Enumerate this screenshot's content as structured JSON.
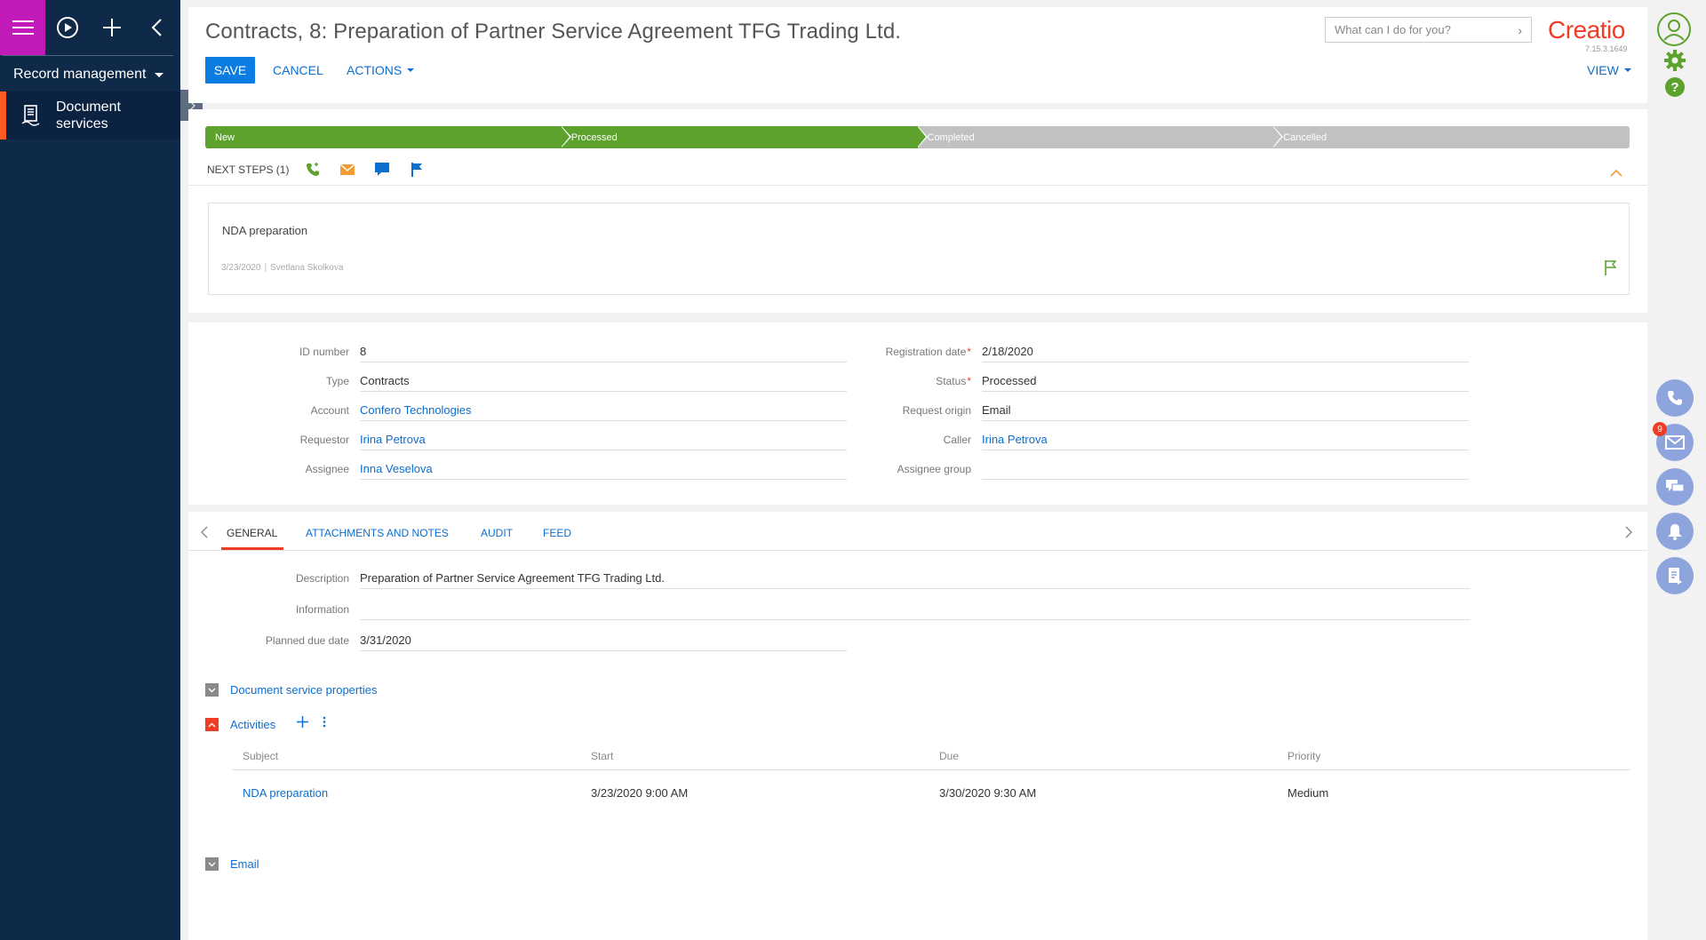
{
  "left_panel": {
    "workplace": "Record management",
    "section": "Document services"
  },
  "header": {
    "title": "Contracts, 8: Preparation of Partner Service Agreement TFG Trading Ltd.",
    "save_label": "SAVE",
    "cancel_label": "CANCEL",
    "actions_label": "ACTIONS",
    "view_label": "VIEW",
    "search_placeholder": "What can I do for you?",
    "logo_text": "Creatio",
    "version": "7.15.3.1649"
  },
  "stages": [
    "New",
    "Processed",
    "Completed",
    "Cancelled"
  ],
  "stage_colors": {
    "done": "#5ca22c",
    "todo": "#c1c1c1"
  },
  "current_stage_index": 1,
  "next_steps": {
    "label": "NEXT STEPS (1)",
    "task": {
      "title": "NDA preparation",
      "date": "3/23/2020",
      "owner": "Svetlana Skolkova"
    }
  },
  "fields": {
    "id_number": {
      "label": "ID number",
      "value": "8"
    },
    "type": {
      "label": "Type",
      "value": "Contracts"
    },
    "account": {
      "label": "Account",
      "value": "Confero Technologies"
    },
    "requestor": {
      "label": "Requestor",
      "value": "Irina Petrova"
    },
    "assignee": {
      "label": "Assignee",
      "value": "Inna Veselova"
    },
    "registration_date": {
      "label": "Registration date",
      "value": "2/18/2020"
    },
    "status": {
      "label": "Status",
      "value": "Processed"
    },
    "request_origin": {
      "label": "Request origin",
      "value": "Email"
    },
    "caller": {
      "label": "Caller",
      "value": "Irina Petrova"
    },
    "assignee_group": {
      "label": "Assignee group",
      "value": ""
    }
  },
  "tabs": {
    "general": "GENERAL",
    "attachments": "ATTACHMENTS AND NOTES",
    "audit": "AUDIT",
    "feed": "FEED"
  },
  "general": {
    "description": {
      "label": "Description",
      "value": "Preparation of Partner Service Agreement TFG Trading Ltd."
    },
    "information": {
      "label": "Information",
      "value": ""
    },
    "planned_due_date": {
      "label": "Planned due date",
      "value": "3/31/2020"
    }
  },
  "detail_groups": {
    "properties": "Document service properties",
    "activities": "Activities",
    "email": "Email"
  },
  "activities_grid": {
    "columns": [
      "Subject",
      "Start",
      "Due",
      "Priority"
    ],
    "rows": [
      {
        "subject": "NDA preparation",
        "start": "3/23/2020 9:00 AM",
        "due": "3/30/2020 9:30 AM",
        "priority": "Medium"
      }
    ]
  },
  "notifications": {
    "email_count": "9"
  },
  "colors": {
    "accent": "#ef3c24",
    "link": "#0b6ed0",
    "sidebar": "#0e2a48",
    "menu_button": "#c11ab9"
  }
}
